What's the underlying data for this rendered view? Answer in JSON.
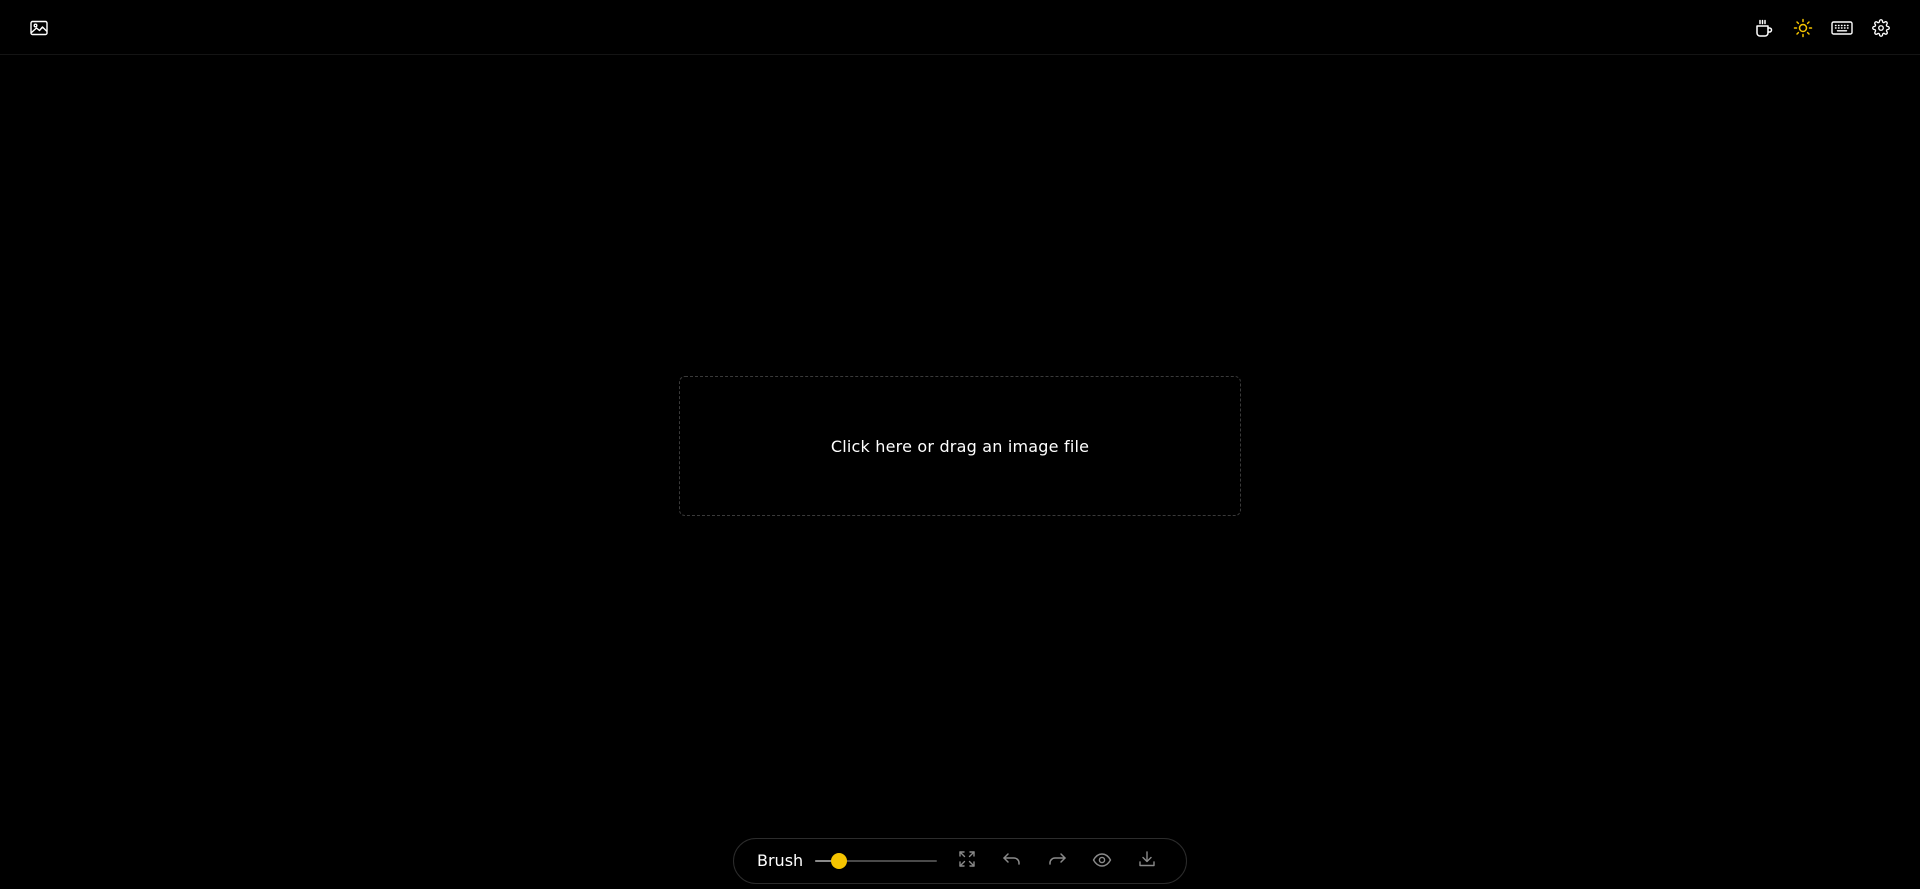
{
  "header": {
    "logo_icon": "image-icon",
    "right_icons": [
      "coffee-icon",
      "sun-icon",
      "keyboard-icon",
      "gear-icon"
    ]
  },
  "dropzone": {
    "text": "Click here or drag an image file"
  },
  "toolbar": {
    "brush_label": "Brush",
    "brush_size_fraction": 0.2,
    "tools": [
      "expand-icon",
      "undo-icon",
      "redo-icon",
      "eye-icon",
      "download-icon"
    ]
  },
  "colors": {
    "background": "#000000",
    "accent": "#f5c400",
    "icon": "#ffffff",
    "icon_muted": "#8a8a8a",
    "border": "#2c2c2c"
  }
}
